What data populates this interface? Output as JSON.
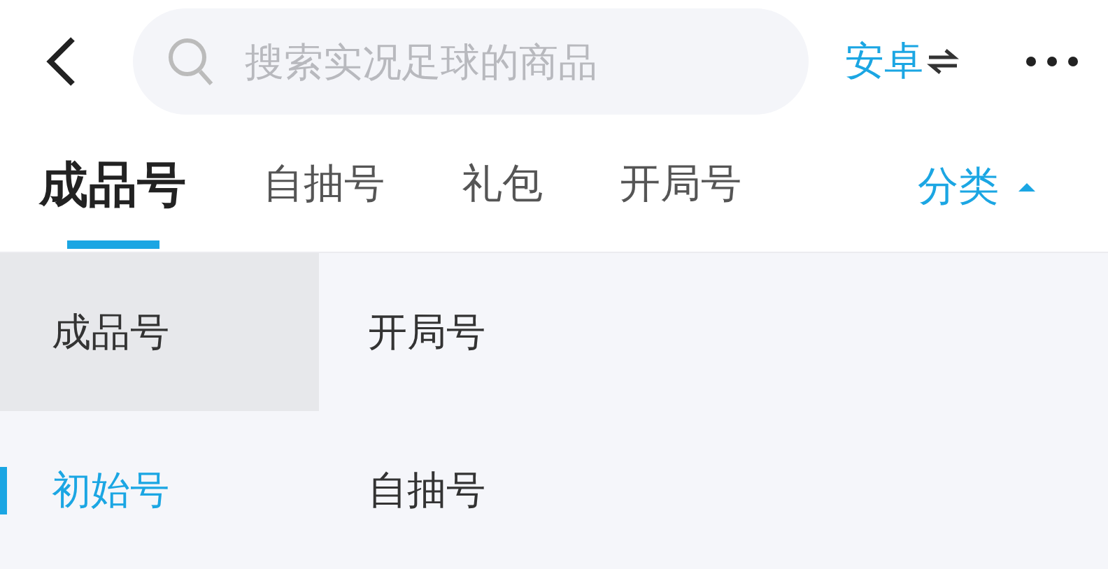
{
  "search": {
    "placeholder": "搜索实况足球的商品"
  },
  "platform": {
    "label": "安卓"
  },
  "tabs": [
    {
      "label": "成品号",
      "selected": true
    },
    {
      "label": "自抽号",
      "selected": false
    },
    {
      "label": "礼包",
      "selected": false
    },
    {
      "label": "开局号",
      "selected": false
    }
  ],
  "category_button": {
    "label": "分类",
    "expanded": true
  },
  "category_panel": {
    "groups": [
      {
        "label": "成品号",
        "highlighted": true,
        "selected": false
      },
      {
        "label": "初始号",
        "highlighted": false,
        "selected": true
      }
    ],
    "options": [
      {
        "label": "开局号"
      },
      {
        "label": "自抽号"
      }
    ]
  }
}
